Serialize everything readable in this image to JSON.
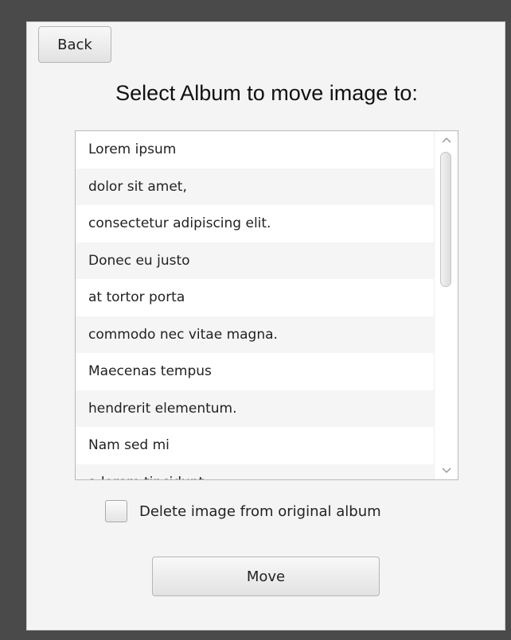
{
  "back_button": {
    "label": "Back"
  },
  "title": "Select Album to move image to:",
  "albums": [
    "Lorem ipsum",
    "dolor sit amet,",
    "consectetur adipiscing elit.",
    "Donec eu justo",
    "at tortor porta",
    "commodo nec vitae magna.",
    "Maecenas tempus",
    "hendrerit elementum.",
    "Nam sed mi",
    "a lorem tincidunt"
  ],
  "delete_checkbox": {
    "label": "Delete image from original album",
    "checked": false
  },
  "move_button": {
    "label": "Move"
  },
  "icons": {
    "scroll_up": "chevron-up-icon",
    "scroll_down": "chevron-down-icon"
  }
}
